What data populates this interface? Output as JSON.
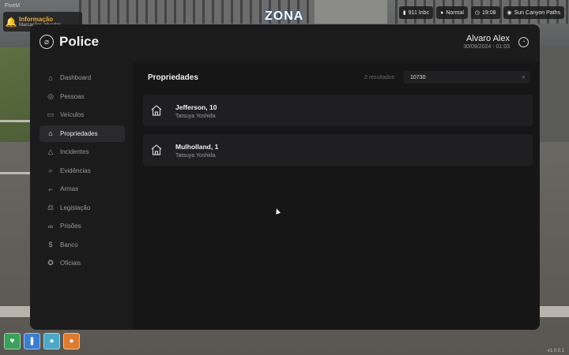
{
  "game": {
    "top_version": "FiveM",
    "zone_text": "ZONA",
    "notification": {
      "title": "Informação",
      "subtitle": "Marcações ativadas"
    },
    "hud": [
      {
        "icon": "signal-icon",
        "text": "911 Inbc"
      },
      {
        "icon": "mic-icon",
        "text": "Normal"
      },
      {
        "icon": "clock-icon",
        "text": "19:08"
      },
      {
        "icon": "location-icon",
        "text": "Sun Canyon Paths"
      }
    ],
    "apps": [
      {
        "icon": "heart-icon",
        "color": "#3aa05a",
        "glyph": "♥"
      },
      {
        "icon": "vest-icon",
        "color": "#3a7ed4",
        "glyph": "❚"
      },
      {
        "icon": "drop-icon",
        "color": "#4aa8c8",
        "glyph": "●"
      },
      {
        "icon": "food-icon",
        "color": "#e07a2e",
        "glyph": "●"
      }
    ],
    "version_text": "v1.0.0.1"
  },
  "app": {
    "title": "Police",
    "user": {
      "name": "Alvaro Alex",
      "date": "30/09/2024 - 01:03"
    }
  },
  "sidebar": {
    "items": [
      {
        "label": "Dashboard",
        "icon": "home-icon",
        "glyph": "⌂"
      },
      {
        "label": "Pessoas",
        "icon": "person-icon",
        "glyph": "◎"
      },
      {
        "label": "Veículos",
        "icon": "car-icon",
        "glyph": "▭"
      },
      {
        "label": "Propriedades",
        "icon": "house-icon",
        "glyph": "⌂",
        "active": true
      },
      {
        "label": "Incidentes",
        "icon": "warning-icon",
        "glyph": "△"
      },
      {
        "label": "Evidências",
        "icon": "search-icon",
        "glyph": "⌕"
      },
      {
        "label": "Armas",
        "icon": "gun-icon",
        "glyph": "⌐"
      },
      {
        "label": "Legislação",
        "icon": "gavel-icon",
        "glyph": "⚖"
      },
      {
        "label": "Prisões",
        "icon": "handcuffs-icon",
        "glyph": "∞"
      },
      {
        "label": "Banco",
        "icon": "dollar-icon",
        "glyph": "$"
      },
      {
        "label": "Oficiais",
        "icon": "badge-icon",
        "glyph": "✪"
      }
    ]
  },
  "main": {
    "title": "Propriedades",
    "results": "2 resultados",
    "search_value": "10730",
    "cards": [
      {
        "title": "Jefferson, 10",
        "owner": "Tatsuya Yoshida"
      },
      {
        "title": "Mulholland, 1",
        "owner": "Tatsuya Yoshida"
      }
    ]
  }
}
